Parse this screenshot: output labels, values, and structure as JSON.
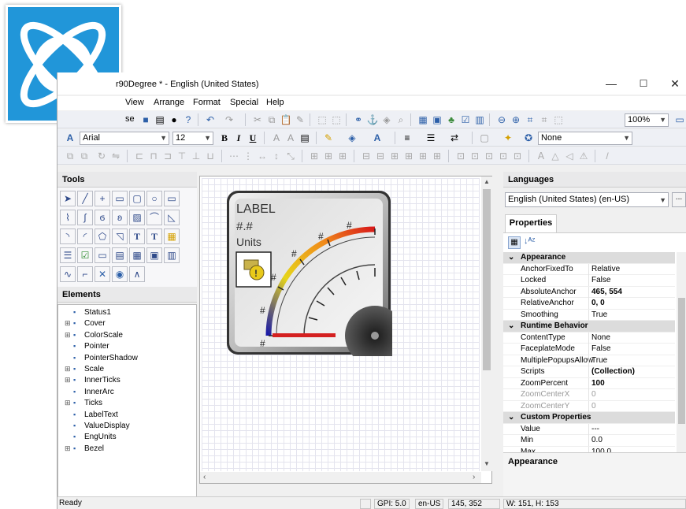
{
  "window": {
    "title": "r90Degree * - English (United States)",
    "minimize": "—",
    "maximize": "☐",
    "close": "✕"
  },
  "menu": [
    "View",
    "Arrange",
    "Format",
    "Special",
    "Help"
  ],
  "toolbar1": {
    "partial_label": "se",
    "zoom": "100%"
  },
  "toolbar2": {
    "font": "Arial",
    "size": "12",
    "bold": "B",
    "italic": "I",
    "underline": "U",
    "style": "None"
  },
  "tools": {
    "title": "Tools"
  },
  "elements": {
    "title": "Elements",
    "items": [
      {
        "label": "Status1",
        "expand": "",
        "indent": 0
      },
      {
        "label": "Cover",
        "expand": "⊞",
        "indent": 0
      },
      {
        "label": "ColorScale",
        "expand": "⊞",
        "indent": 0
      },
      {
        "label": "Pointer",
        "expand": "",
        "indent": 0
      },
      {
        "label": "PointerShadow",
        "expand": "",
        "indent": 0
      },
      {
        "label": "Scale",
        "expand": "⊞",
        "indent": 0
      },
      {
        "label": "InnerTicks",
        "expand": "⊞",
        "indent": 0
      },
      {
        "label": "InnerArc",
        "expand": "",
        "indent": 0
      },
      {
        "label": "Ticks",
        "expand": "⊞",
        "indent": 0
      },
      {
        "label": "LabelText",
        "expand": "",
        "indent": 0
      },
      {
        "label": "ValueDisplay",
        "expand": "",
        "indent": 0
      },
      {
        "label": "EngUnits",
        "expand": "",
        "indent": 0
      },
      {
        "label": "Bezel",
        "expand": "⊞",
        "indent": 0
      }
    ]
  },
  "gauge": {
    "label": "LABEL",
    "value": "#.#",
    "units": "Units",
    "tick": "#"
  },
  "languages": {
    "title": "Languages",
    "selected": "English (United States) (en-US)",
    "more": "..."
  },
  "properties": {
    "tab": "Properties",
    "rows": [
      {
        "type": "cat",
        "key": "Appearance",
        "value": ""
      },
      {
        "type": "row",
        "key": "AnchorFixedTo",
        "value": "Relative"
      },
      {
        "type": "row",
        "key": "Locked",
        "value": "False"
      },
      {
        "type": "row",
        "key": "AbsoluteAnchor",
        "value": "465, 554",
        "bold": true
      },
      {
        "type": "row",
        "key": "RelativeAnchor",
        "value": "0, 0",
        "bold": true
      },
      {
        "type": "row",
        "key": "Smoothing",
        "value": "True"
      },
      {
        "type": "cat",
        "key": "Runtime Behavior",
        "value": ""
      },
      {
        "type": "row",
        "key": "ContentType",
        "value": "None"
      },
      {
        "type": "row",
        "key": "FaceplateMode",
        "value": "False"
      },
      {
        "type": "row",
        "key": "MultiplePopupsAllow",
        "value": "True"
      },
      {
        "type": "row",
        "key": "Scripts",
        "value": "(Collection)",
        "bold": true
      },
      {
        "type": "row",
        "key": "ZoomPercent",
        "value": "100",
        "bold": true
      },
      {
        "type": "gray",
        "key": "ZoomCenterX",
        "value": "0"
      },
      {
        "type": "gray",
        "key": "ZoomCenterY",
        "value": "0"
      },
      {
        "type": "cat",
        "key": "Custom Properties",
        "value": ""
      },
      {
        "type": "row",
        "key": "Value",
        "value": "---"
      },
      {
        "type": "row",
        "key": "Min",
        "value": "0.0"
      },
      {
        "type": "row",
        "key": "Max",
        "value": "100.0"
      }
    ],
    "description": "Appearance"
  },
  "status": {
    "ready": "Ready",
    "gpi": "GPI: 5.0",
    "locale": "en-US",
    "coords": "145, 352",
    "size": "W: 151, H: 153"
  },
  "colors": {
    "logo_bg": "#2196d9",
    "accent": "#2c5fa8"
  }
}
